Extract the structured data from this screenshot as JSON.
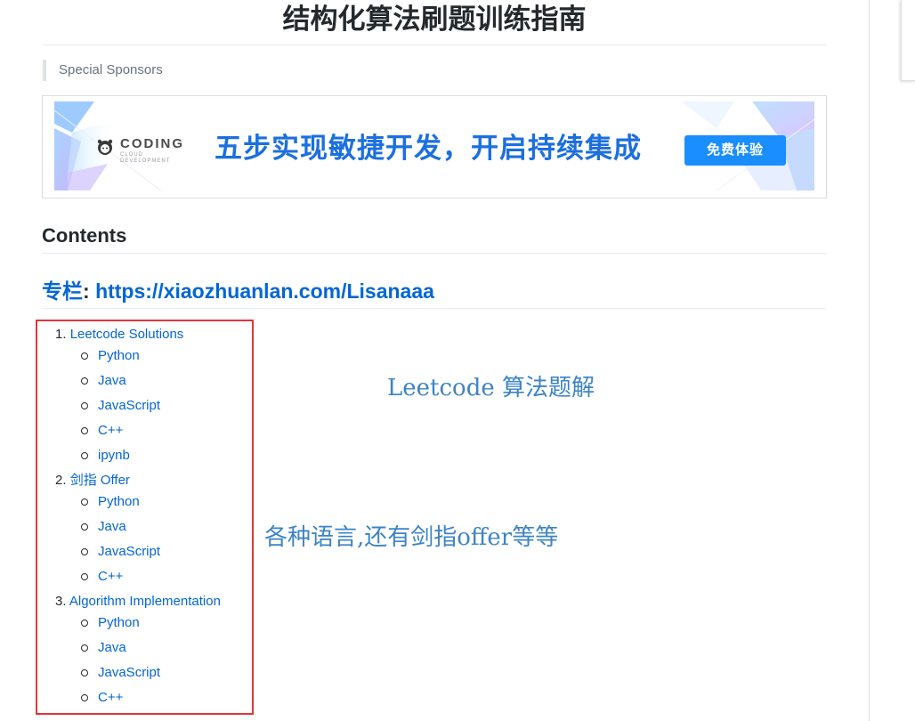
{
  "title": "结构化算法刷题训练指南",
  "sponsors_label": "Special Sponsors",
  "banner": {
    "logo_text": "CODING",
    "logo_subtext": "CLOUD DEVELOPMENT",
    "slogan": "五步实现敏捷开发，开启持续集成",
    "button": "免费体验",
    "accent": "#1c6fe0"
  },
  "contents_heading": "Contents",
  "column": {
    "label": "专栏",
    "colon": ":",
    "url": "https://xiaozhuanlan.com/Lisanaaa"
  },
  "toc": [
    {
      "num": "1.",
      "label": "Leetcode Solutions",
      "items": [
        "Python",
        "Java",
        "JavaScript",
        "C++",
        "ipynb"
      ]
    },
    {
      "num": "2.",
      "label": "剑指 Offer",
      "items": [
        "Python",
        "Java",
        "JavaScript",
        "C++"
      ]
    },
    {
      "num": "3.",
      "label": "Algorithm Implementation",
      "items": [
        "Python",
        "Java",
        "JavaScript",
        "C++"
      ]
    }
  ],
  "annotations": {
    "note1": "Leetcode 算法题解",
    "note2": "各种语言,还有剑指offer等等"
  },
  "colors": {
    "link": "#0366d6",
    "highlight_box": "#e3343a",
    "annotation": "#3d84c6"
  }
}
